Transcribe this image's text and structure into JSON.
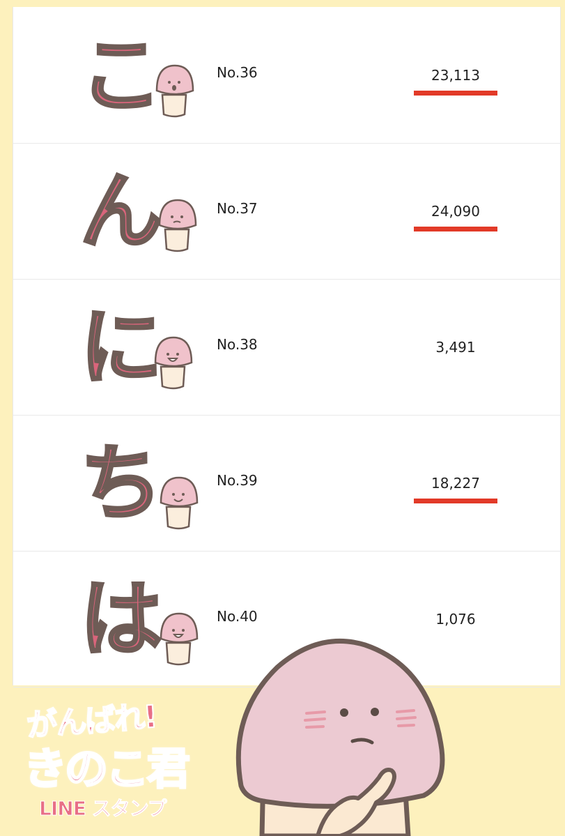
{
  "rows": [
    {
      "char": "こ",
      "number": "No.36",
      "count": "23,113",
      "underlined": true
    },
    {
      "char": "ん",
      "number": "No.37",
      "count": "24,090",
      "underlined": true
    },
    {
      "char": "に",
      "number": "No.38",
      "count": "3,491",
      "underlined": false
    },
    {
      "char": "ち",
      "number": "No.39",
      "count": "18,227",
      "underlined": true
    },
    {
      "char": "は",
      "number": "No.40",
      "count": "1,076",
      "underlined": false
    }
  ],
  "logo": {
    "line1": "がんばれ!",
    "line2": "きのこ君",
    "line3": "LINE スタンプ"
  },
  "colors": {
    "background": "#fdf1bd",
    "stamp_pink": "#d9657b",
    "outline": "#6e5c56",
    "underline": "#e23a28",
    "mascot_pink": "#eccad2"
  }
}
